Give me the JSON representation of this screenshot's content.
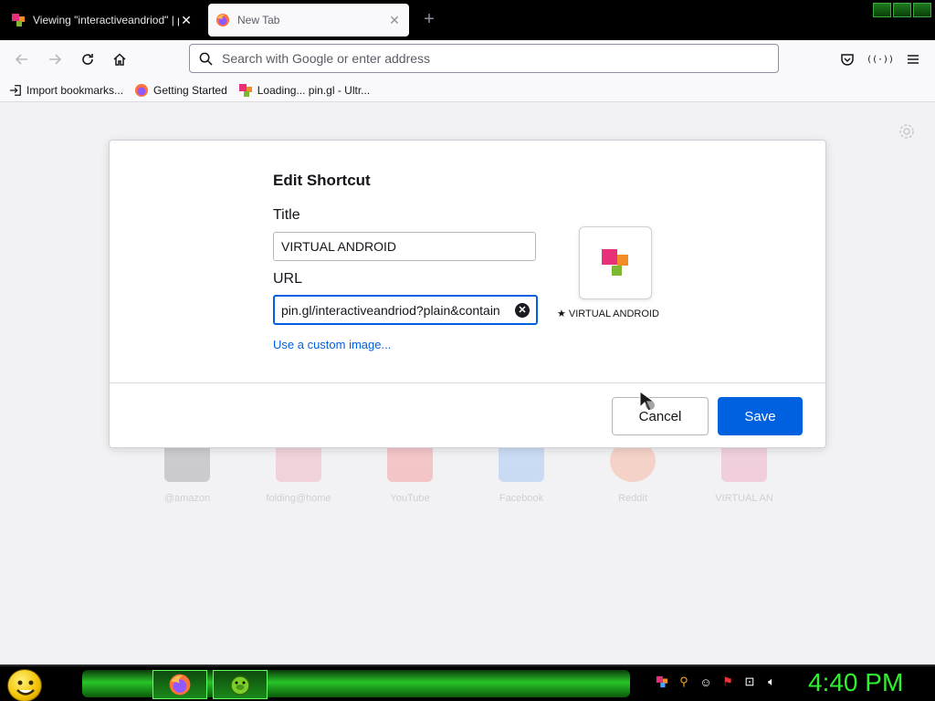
{
  "browser": {
    "tabs": [
      {
        "title": "Viewing \"interactiveandriod\" | p",
        "active": false
      },
      {
        "title": "New Tab",
        "active": true
      }
    ],
    "address_placeholder": "Search with Google or enter address",
    "bookmarks": [
      {
        "label": "Import bookmarks...",
        "icon": "import-icon"
      },
      {
        "label": "Getting Started",
        "icon": "firefox-icon"
      },
      {
        "label": "Loading... pin.gl - Ultr...",
        "icon": "pingl-icon"
      }
    ]
  },
  "dialog": {
    "heading": "Edit Shortcut",
    "title_label": "Title",
    "title_value": "VIRTUAL ANDROID",
    "url_label": "URL",
    "url_value": "pin.gl/interactiveandriod?plain&contain",
    "custom_image_link": "Use a custom image...",
    "preview_label": "VIRTUAL ANDROID",
    "cancel_label": "Cancel",
    "save_label": "Save"
  },
  "background_tiles": [
    {
      "label": "@amazon"
    },
    {
      "label": "folding@home"
    },
    {
      "label": "YouTube"
    },
    {
      "label": "Facebook"
    },
    {
      "label": "Reddit"
    },
    {
      "label": "VIRTUAL AN"
    }
  ],
  "taskbar": {
    "clock": "4:40 PM"
  },
  "colors": {
    "accent": "#0061e0",
    "clock_green": "#2ff02f"
  }
}
